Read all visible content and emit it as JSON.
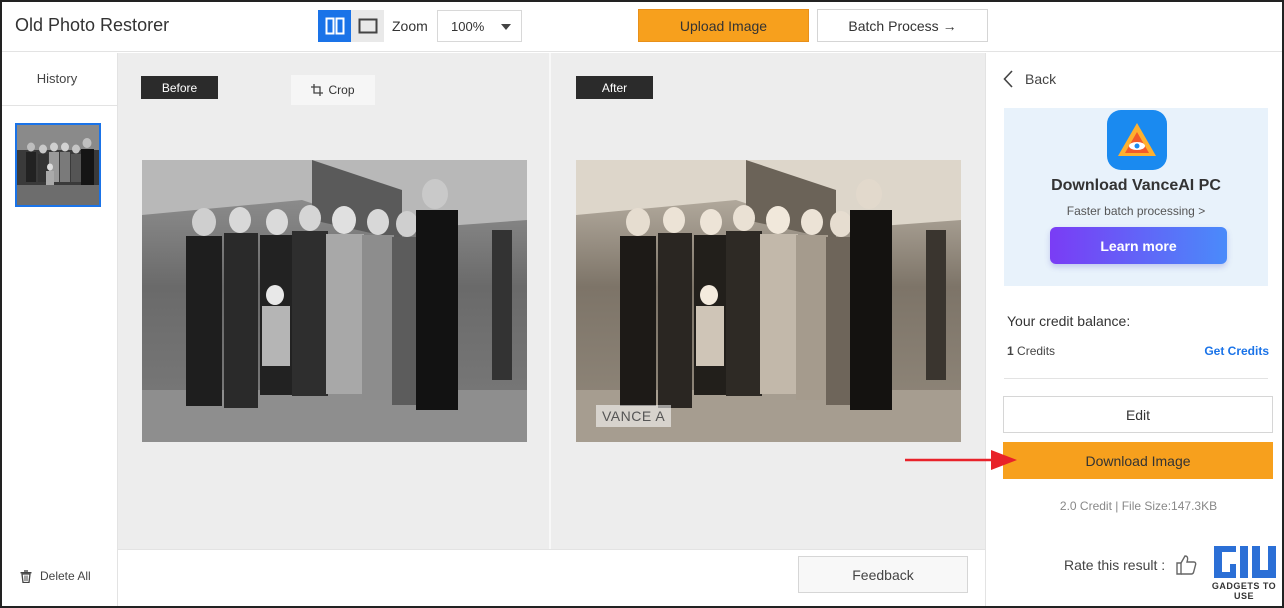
{
  "header": {
    "title": "Old Photo Restorer",
    "zoom_label": "Zoom",
    "zoom_value": "100%",
    "upload_label": "Upload Image",
    "batch_label": "Batch Process →"
  },
  "history": {
    "title": "History",
    "delete_all_label": "Delete All"
  },
  "main": {
    "before_label": "Before",
    "after_label": "After",
    "crop_label": "Crop",
    "watermark_text": "VANCE A"
  },
  "bottom": {
    "feedback_label": "Feedback"
  },
  "right_panel": {
    "back_label": "Back",
    "ad_title": "Download VanceAI PC",
    "ad_subtitle": "Faster batch processing >",
    "learn_more_label": "Learn more",
    "credit_balance_label": "Your credit balance:",
    "credit_count": "1",
    "credit_unit": "Credits",
    "get_credits_label": "Get Credits",
    "edit_label": "Edit",
    "download_label": "Download Image",
    "file_info": "2.0 Credit | File Size:147.3KB",
    "rate_label": "Rate this result :"
  },
  "brand": {
    "logo_text": "GADGETS TO USE"
  },
  "colors": {
    "accent_blue": "#1a73e8",
    "orange": "#f7a01d",
    "annotation_red": "#e8222a"
  }
}
